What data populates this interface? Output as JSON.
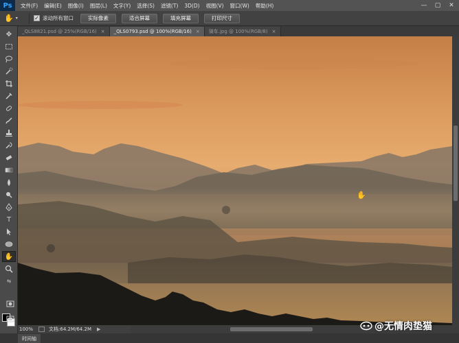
{
  "app": {
    "logo_text": "Ps"
  },
  "menu": [
    "文件(F)",
    "编辑(E)",
    "图像(I)",
    "图层(L)",
    "文字(Y)",
    "选择(S)",
    "滤镜(T)",
    "3D(D)",
    "视图(V)",
    "窗口(W)",
    "帮助(H)"
  ],
  "window_controls": {
    "minimize": "—",
    "restore": "▢",
    "close": "✕"
  },
  "options_bar": {
    "tool_icon": "hand-tool-icon",
    "scroll_all_windows_label": "滚动所有窗口",
    "scroll_all_windows_checked": true,
    "buttons": [
      "实际像素",
      "适合屏幕",
      "填充屏幕",
      "打印尺寸"
    ]
  },
  "tabs": [
    {
      "label": "_QLS8821.psd @ 25%(RGB/16)",
      "active": false
    },
    {
      "label": "_QLS0793.psd @ 100%(RGB/16)",
      "active": true
    },
    {
      "label": "骑车.jpg @ 100%(RGB/8)",
      "active": false
    }
  ],
  "tab_close_glyph": "×",
  "status": {
    "zoom": "100%",
    "doc_info": "文档:64.2M/64.2M",
    "arrow": "▶"
  },
  "bottom_panel": {
    "tab_label": "时间轴"
  },
  "watermark": {
    "text": "@无情肉垫猫"
  },
  "colors": {
    "foreground": "#000000",
    "background": "#ffffff",
    "sky_top": "#c98248",
    "sky_glow": "#e6a86a"
  }
}
